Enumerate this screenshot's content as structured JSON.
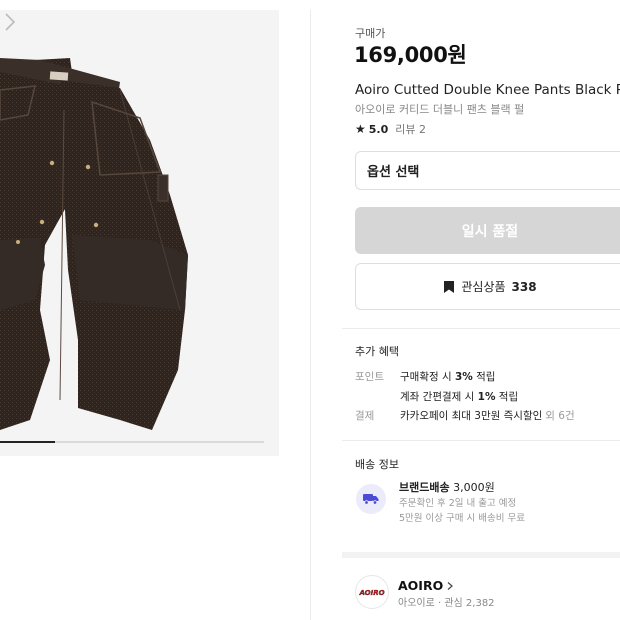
{
  "gallery": {
    "image_alt": "black double knee carpenter pants",
    "next_icon": "chevron-right-icon",
    "progress": 0.21
  },
  "product": {
    "price_label": "구매가",
    "price": "169,000원",
    "title": "Aoiro Cutted Double Knee Pants Black Pea",
    "subtitle": "아오이로 커티드 더블니 팬츠 블랙 펄",
    "rating_score": "5.0",
    "reviews": "리뷰 2"
  },
  "options": {
    "select_label": "옵션 선택"
  },
  "actions": {
    "soldout_label": "일시 품절",
    "wish_label": "관심상품",
    "wish_count": "338"
  },
  "benefits": {
    "title": "추가 혜택",
    "point_label": "포인트",
    "point_line1_pre": "구매확정 시 ",
    "point_line1_rate": "3%",
    "point_line1_post": " 적립",
    "point_line2_pre": "계좌 간편결제 시 ",
    "point_line2_rate": "1%",
    "point_line2_post": " 적립",
    "payment_label": "결제",
    "payment_text": "카카오페이 최대 3만원 즉시할인",
    "payment_more": "외 6건"
  },
  "shipping": {
    "title": "배송 정보",
    "method": "브랜드배송",
    "fee": "3,000원",
    "schedule": "주문확인 후 2일 내 출고 예정",
    "free_note": "5만원 이상 구매 시 배송비 무료"
  },
  "brand": {
    "name": "AOIRO",
    "meta": "아오이로 · 관심 2,382",
    "logo_text": "AOIRO"
  },
  "colors": {
    "accent_ship_bg": "#ebebfb",
    "accent_ship_icon": "#4b4bd6",
    "soldout_bg": "#d6d6d6",
    "pants_base": "#2f2622",
    "logo_red": "#b81d24"
  }
}
